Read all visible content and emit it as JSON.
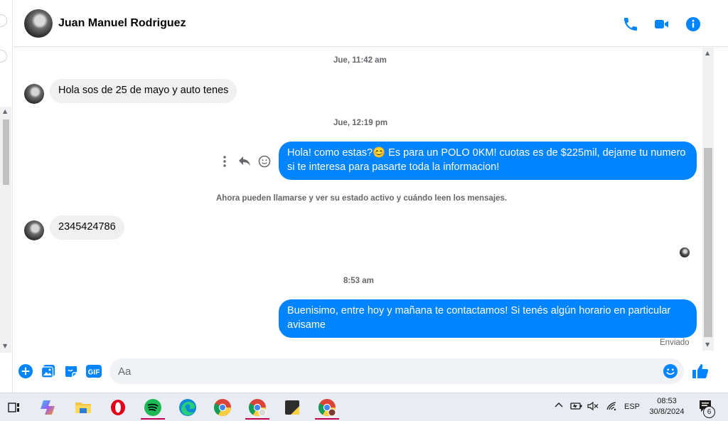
{
  "conversation": {
    "contact_name": "Juan Manuel Rodriguez",
    "header_icons": [
      "phone-icon",
      "video-camera-icon",
      "info-icon"
    ]
  },
  "messages": {
    "t1": "Jue, 11:42 am",
    "m1": "Hola sos de 25 de mayo  y auto tenes",
    "t2": "Jue, 12:19 pm",
    "m2": "Hola! como estas?😊 Es para un POLO 0KM! cuotas es de $225mil, dejame tu numero si te interesa para pasarte toda la informacion!",
    "notice": "Ahora pueden llamarse y ver su estado activo y cuándo leen los mensajes.",
    "m3": "2345424786",
    "t3": "8:53 am",
    "m4": "Buenisimo, entre hoy y mañana te contactamos! Si tenés algún horario en particular avisame",
    "status": "Enviado"
  },
  "composer": {
    "placeholder": "Aa",
    "gif_label": "GIF"
  },
  "colors": {
    "accent": "#0084ff",
    "incoming_bubble": "#f0f0f0"
  },
  "taskbar": {
    "apps": [
      "task-view",
      "copilot",
      "file-explorer",
      "opera",
      "spotify",
      "edge",
      "chrome",
      "chrome-profile",
      "sticky-notes",
      "chrome-profile-2"
    ],
    "language": "ESP",
    "time": "08:53",
    "date": "30/8/2024",
    "notification_count": "6"
  }
}
